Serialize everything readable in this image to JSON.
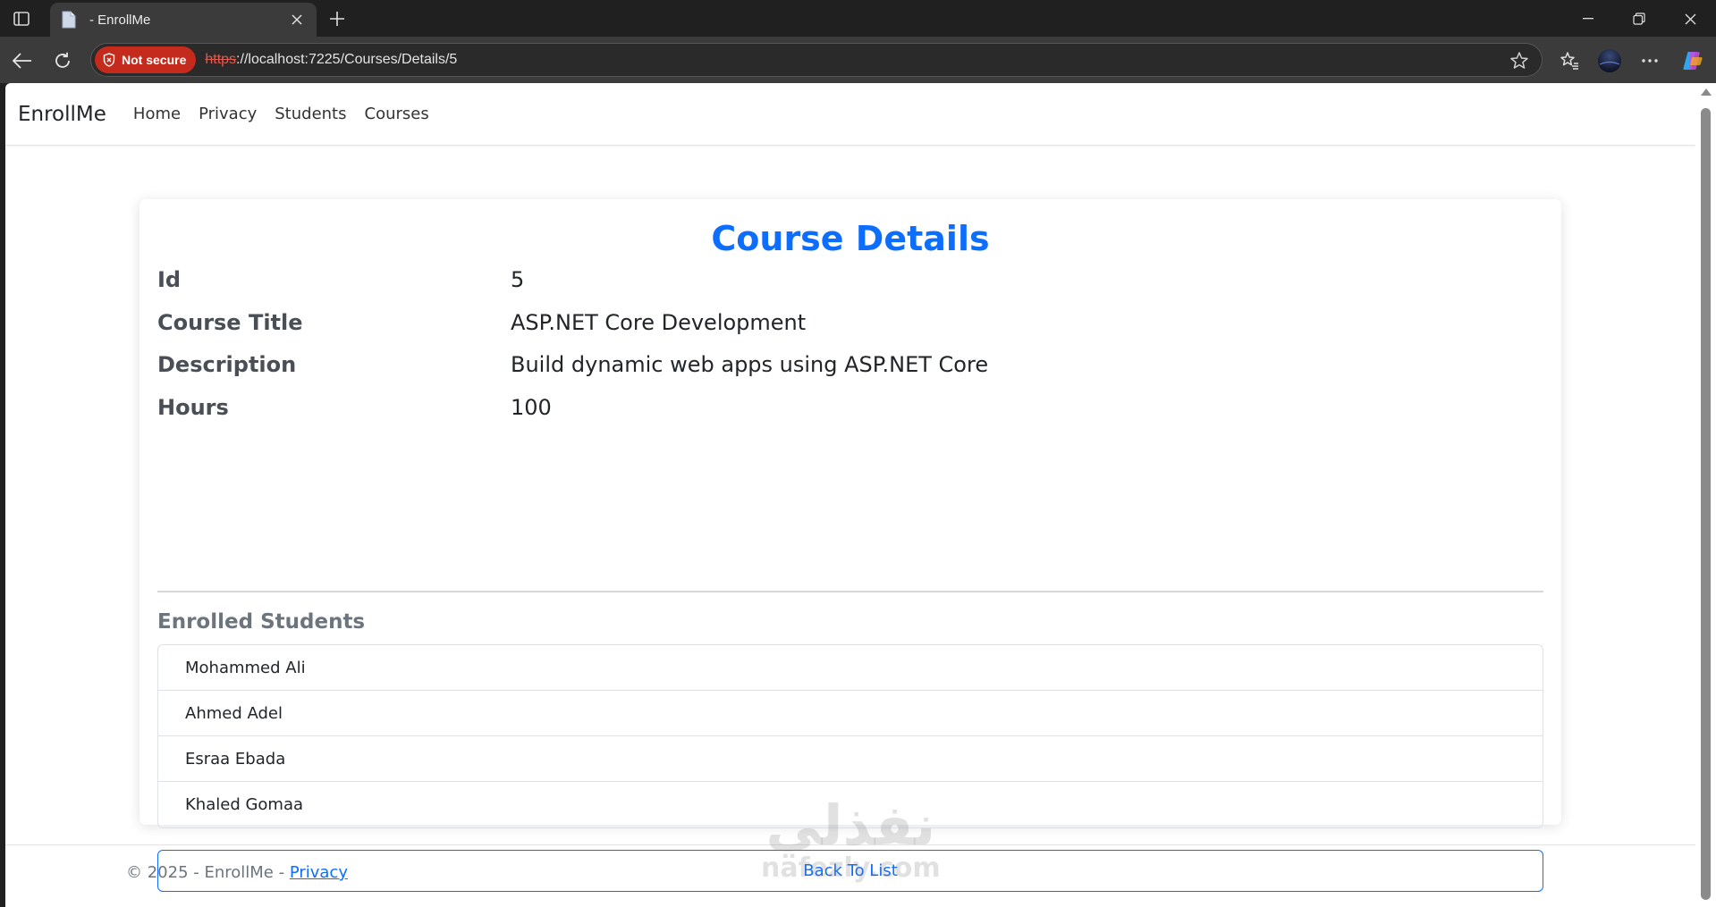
{
  "browser": {
    "tab_title": "- EnrollMe",
    "security_label": "Not secure",
    "url_scheme": "https",
    "url_rest": "://localhost:7225/Courses/Details/5"
  },
  "navbar": {
    "brand": "EnrollMe",
    "links": [
      "Home",
      "Privacy",
      "Students",
      "Courses"
    ]
  },
  "details": {
    "title": "Course Details",
    "rows": [
      {
        "label": "Id",
        "value": "5"
      },
      {
        "label": "Course Title",
        "value": "ASP.NET Core Development"
      },
      {
        "label": "Description",
        "value": "Build dynamic web apps using ASP.NET Core"
      },
      {
        "label": "Hours",
        "value": "100"
      }
    ],
    "enrolled_title": "Enrolled Students",
    "students": [
      "Mohammed Ali",
      "Ahmed Adel",
      "Esraa Ebada",
      "Khaled Gomaa"
    ],
    "back_label": "Back To List"
  },
  "footer": {
    "text": "© 2025 - EnrollMe - ",
    "privacy_link": "Privacy"
  },
  "watermark": {
    "logo_text": "نفذلي",
    "text": "nafezly.com"
  },
  "colors": {
    "primary": "#0d6efd",
    "danger_badge": "#c42b1c",
    "muted": "#6c757d"
  }
}
